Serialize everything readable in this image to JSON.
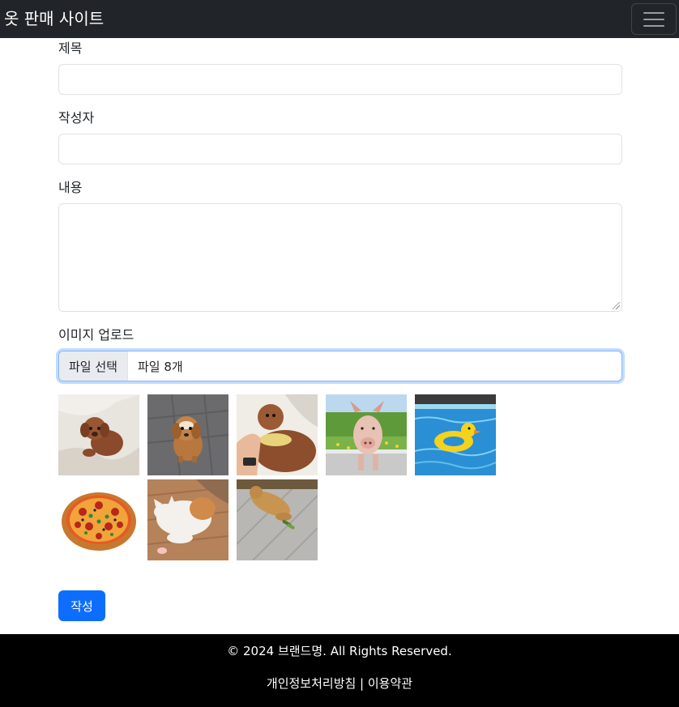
{
  "navbar": {
    "brand": "옷 판매 사이트",
    "toggle_icon": "hamburger-menu-icon"
  },
  "form": {
    "title_label": "제목",
    "title_value": "",
    "author_label": "작성자",
    "author_value": "",
    "content_label": "내용",
    "content_value": "",
    "image_label": "이미지 업로드",
    "file_button": "파일 선택",
    "file_status": "파일 8개",
    "thumbnails": [
      "puppy on bed",
      "puppy on floor",
      "puppy held in hand",
      "pig at fence",
      "duck float in pool",
      "pizza",
      "cat lying on floor",
      "dog lying on tiles"
    ],
    "submit": "작성"
  },
  "footer": {
    "copyright": "© 2024 브랜드명. All Rights Reserved.",
    "links": "개인정보처리방침 | 이용약관"
  },
  "colors": {
    "navbar_bg": "#212529",
    "primary": "#0d6efd",
    "footer_bg": "#000000"
  }
}
